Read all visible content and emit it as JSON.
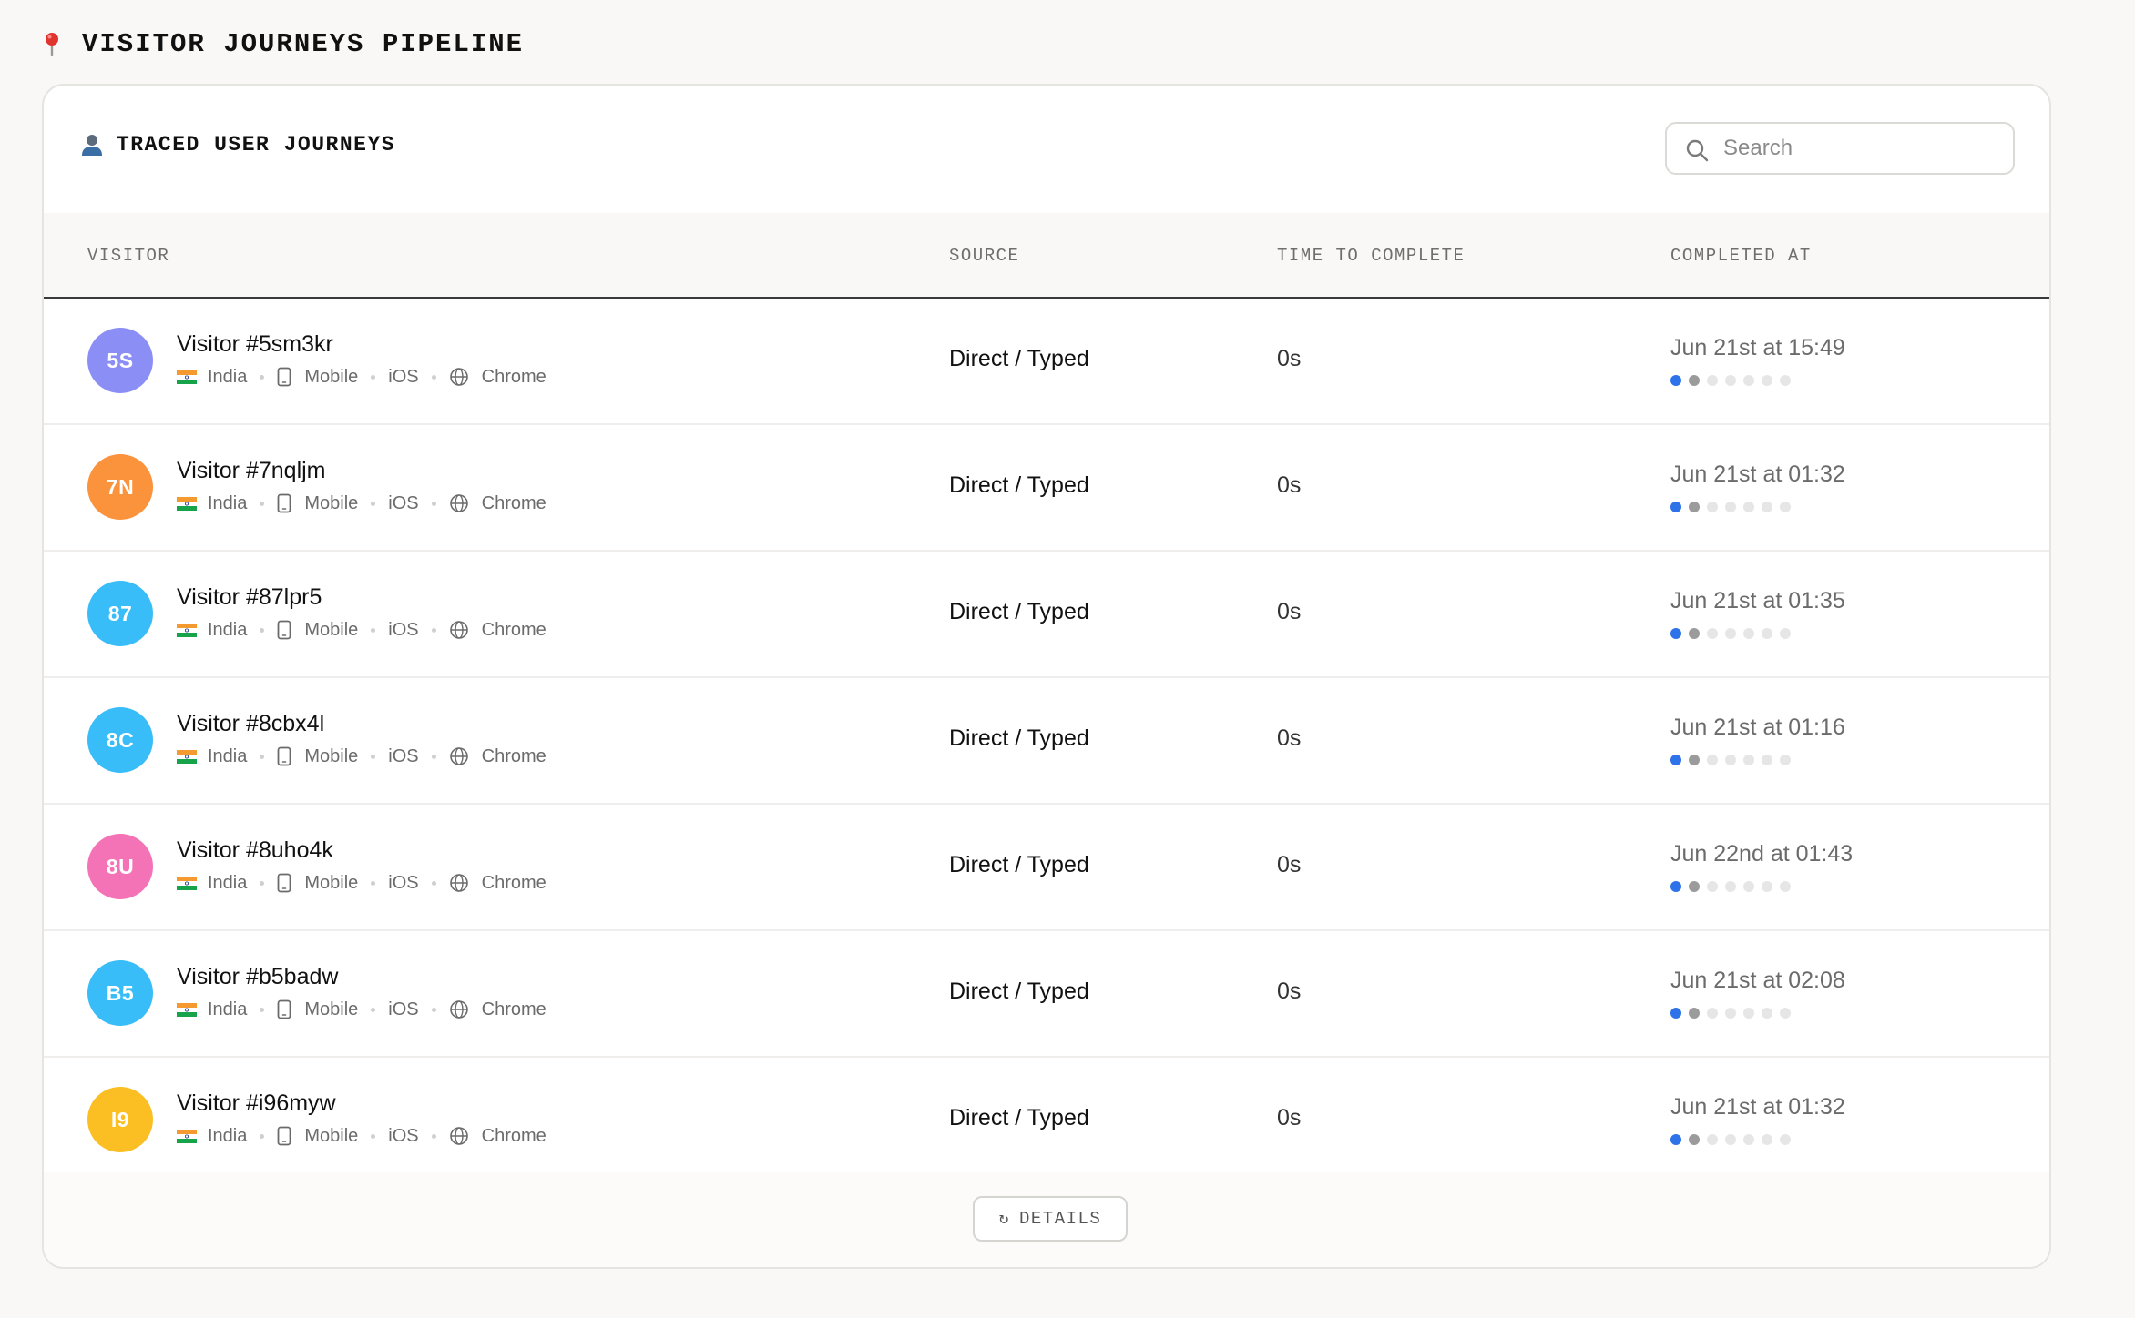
{
  "page": {
    "title": "VISITOR JOURNEYS PIPELINE",
    "title_icon": "map-pin-icon"
  },
  "card": {
    "title": "TRACED USER JOURNEYS",
    "title_icon": "user-icon",
    "search": {
      "placeholder": "Search",
      "value": ""
    }
  },
  "table": {
    "columns": [
      "VISITOR",
      "SOURCE",
      "TIME TO COMPLETE",
      "COMPLETED AT"
    ],
    "rows": [
      {
        "initials": "5S",
        "avatar_color": "#8b8ff5",
        "name": "Visitor #5sm3kr",
        "country": "India",
        "device": "Mobile",
        "os": "iOS",
        "browser": "Chrome",
        "source": "Direct / Typed",
        "duration": "0s",
        "completed": "Jun 21st at 15:49"
      },
      {
        "initials": "7N",
        "avatar_color": "#fb923c",
        "name": "Visitor #7nqljm",
        "country": "India",
        "device": "Mobile",
        "os": "iOS",
        "browser": "Chrome",
        "source": "Direct / Typed",
        "duration": "0s",
        "completed": "Jun 21st at 01:32"
      },
      {
        "initials": "87",
        "avatar_color": "#38bdf8",
        "name": "Visitor #87lpr5",
        "country": "India",
        "device": "Mobile",
        "os": "iOS",
        "browser": "Chrome",
        "source": "Direct / Typed",
        "duration": "0s",
        "completed": "Jun 21st at 01:35"
      },
      {
        "initials": "8C",
        "avatar_color": "#38bdf8",
        "name": "Visitor #8cbx4l",
        "country": "India",
        "device": "Mobile",
        "os": "iOS",
        "browser": "Chrome",
        "source": "Direct / Typed",
        "duration": "0s",
        "completed": "Jun 21st at 01:16"
      },
      {
        "initials": "8U",
        "avatar_color": "#f472b6",
        "name": "Visitor #8uho4k",
        "country": "India",
        "device": "Mobile",
        "os": "iOS",
        "browser": "Chrome",
        "source": "Direct / Typed",
        "duration": "0s",
        "completed": "Jun 22nd at 01:43"
      },
      {
        "initials": "B5",
        "avatar_color": "#38bdf8",
        "name": "Visitor #b5badw",
        "country": "India",
        "device": "Mobile",
        "os": "iOS",
        "browser": "Chrome",
        "source": "Direct / Typed",
        "duration": "0s",
        "completed": "Jun 21st at 02:08"
      },
      {
        "initials": "I9",
        "avatar_color": "#fbbf24",
        "name": "Visitor #i96myw",
        "country": "India",
        "device": "Mobile",
        "os": "iOS",
        "browser": "Chrome",
        "source": "Direct / Typed",
        "duration": "0s",
        "completed": "Jun 21st at 01:32"
      }
    ],
    "progress_steps_total": 7,
    "progress_dot_colors": [
      "#2d72e8",
      "#9b9b9b",
      "#e6e6e6",
      "#e6e6e6",
      "#e6e6e6",
      "#e6e6e6",
      "#e6e6e6"
    ]
  },
  "footer": {
    "details_label": "DETAILS",
    "details_icon": "refresh-icon"
  }
}
